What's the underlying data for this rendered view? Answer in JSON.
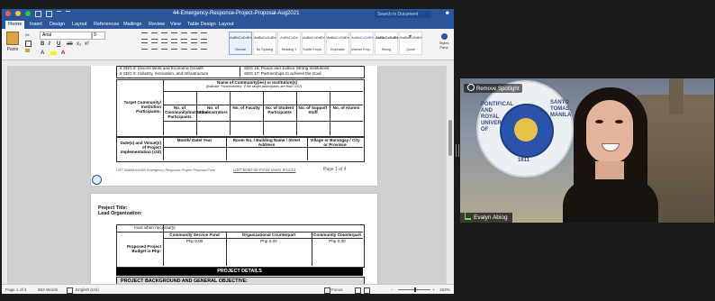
{
  "word": {
    "doc_title": "44-Emergency-Response-Project-Proposal-Aug2021",
    "search_placeholder": "Search in Document",
    "tabs": [
      "Home",
      "Insert",
      "Design",
      "Layout",
      "References",
      "Mailings",
      "Review",
      "View",
      "Table Design",
      "Layout"
    ],
    "ribbon": {
      "paste_label": "Paste",
      "font_name": "Arial",
      "font_size": "9",
      "bold": "B",
      "italic": "I",
      "underline": "U",
      "styles_pane_label": "Styles Pane",
      "styles": [
        {
          "sample": "AaBbCcDdEe",
          "name": "Normal"
        },
        {
          "sample": "AaBbCcDdEe",
          "name": "No Spacing"
        },
        {
          "sample": "AaBbCcDe",
          "name": "Heading 1"
        },
        {
          "sample": "AaBbCcDdEe",
          "name": "Subtle Emph..."
        },
        {
          "sample": "AaBbCcDdEe",
          "name": "Emphasis"
        },
        {
          "sample": "AaBbCcDdEe",
          "name": "Intense Emp..."
        },
        {
          "sample": "AaBbCcDdEe",
          "name": "Strong"
        },
        {
          "sample": "AaBbCcDdEe",
          "name": "Quote"
        }
      ]
    },
    "page1": {
      "sdg_left_1": "8 SDG 8: Decent Work and Economic Growth",
      "sdg_left_2": "9 SDG 9: Industry, Innovation, and Infrastructure",
      "sdg_right_1": "SDG 16: Peace and Justice Strong Institutions",
      "sdg_right_2": "SDG 17: Partnerships to achieve the Goal",
      "community_header": "Name of Community(ies) or Institution(s)",
      "community_sub": "(Indicate \"Homeowners\" if the target participants are from UST)",
      "target_label": "Target Community/ Institution Participants:",
      "col_headers": [
        "No. of Community/Institution Participants",
        "No. of Administrators",
        "No. of Faculty",
        "No. of Student Participants",
        "No. of Support Staff",
        "No. of Alumni"
      ],
      "venue_label": "Date(s) and Venue(s) of Project Implementation (ctd)",
      "venue_headers": [
        "Month/ Date/ Year",
        "Room No. / Building Name / Street Address",
        "Village or Barangay / City or Province"
      ],
      "footer_left": "UST SIMBAHAYAN Emergency Response Project Proposal Form",
      "footer_code": "UST:S040-00-FO44 rev01 9/11/21",
      "footer_page": "Page 1 of 4"
    },
    "page2": {
      "project_title": "Project Title:",
      "lead_org": "Lead Organization:",
      "rows_note": "rows when necessary)",
      "budget_headers": [
        "Community Service Fund",
        "Organizational Counterpart",
        "Community Counterpart"
      ],
      "budget_label": "Proposed Project Budget in Php:",
      "budget_values": [
        "Php 0.00",
        "Php 0.00",
        "Php 0.00"
      ],
      "details_bar": "PROJECT DETAILS",
      "background_bar": "PROJECT BACKGROUND AND GENERAL OBJECTIVE:"
    },
    "status": {
      "page": "Page 1 of 4",
      "words": "863 Words",
      "language": "English (US)",
      "focus": "Focus",
      "zoom": "162%"
    }
  },
  "video": {
    "spotlight_label": "Remove Spotlight",
    "participant_name": "Evalyn Abiog",
    "seal_text_left": "PONTIFICAL AND ROYAL UNIVERSITY OF",
    "seal_text_right": "SANTO TOMAS, MANILA",
    "seal_year": "1611"
  }
}
